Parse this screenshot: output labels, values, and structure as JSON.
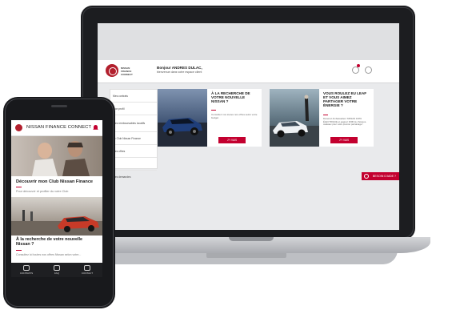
{
  "laptop": {
    "brand_small": "NISSAN FINANCE CONNECT",
    "greeting": "Bonjour ANDRES DULAC,",
    "greeting_sub": "bienvenue dans votre espace client",
    "notification_count": "1",
    "side_menu": [
      "Mes contrats",
      "Mon profil",
      "Mes remboursables locatifs",
      "Le Club Nissan Finance",
      "Mes offres",
      "",
      "Mes demandes"
    ],
    "cards": [
      {
        "title": "À LA RECHERCHE DE VOTRE NOUVELLE NISSAN ?",
        "text": "Consultez nos toutes nos offres selon votre budget",
        "button": "J'Y VAIS"
      },
      {
        "title": "VOUS ROULEZ EU LEAF ET VOUS AIMEZ PARTAGER VOTRE ÉNERGIE ?",
        "text": "Devenez Ambassadeur NISSAN 100% ÉLECTRIQUE et gagnez 300€ de chèques-cadeaux pour votre premier parrainage !",
        "button": "J'Y VAIS"
      }
    ],
    "help_button": "BESOIN D'AIDE ?"
  },
  "phone": {
    "brand": "NISSAN FINANCE CONNECT",
    "card1_title": "Découvrir mon Club Nissan Finance",
    "card1_sub": "Pour découvrir et profiter du votre Club",
    "card2_title": "À la recherche de votre nouvelle Nissan ?",
    "card2_sub": "Consultez ici toutes nos offres Nissan selon votre...",
    "nav": [
      "CONTRATS",
      "FAQ",
      "CONTACT"
    ]
  },
  "colors": {
    "accent": "#c3002f",
    "dark": "#1c1d20"
  }
}
